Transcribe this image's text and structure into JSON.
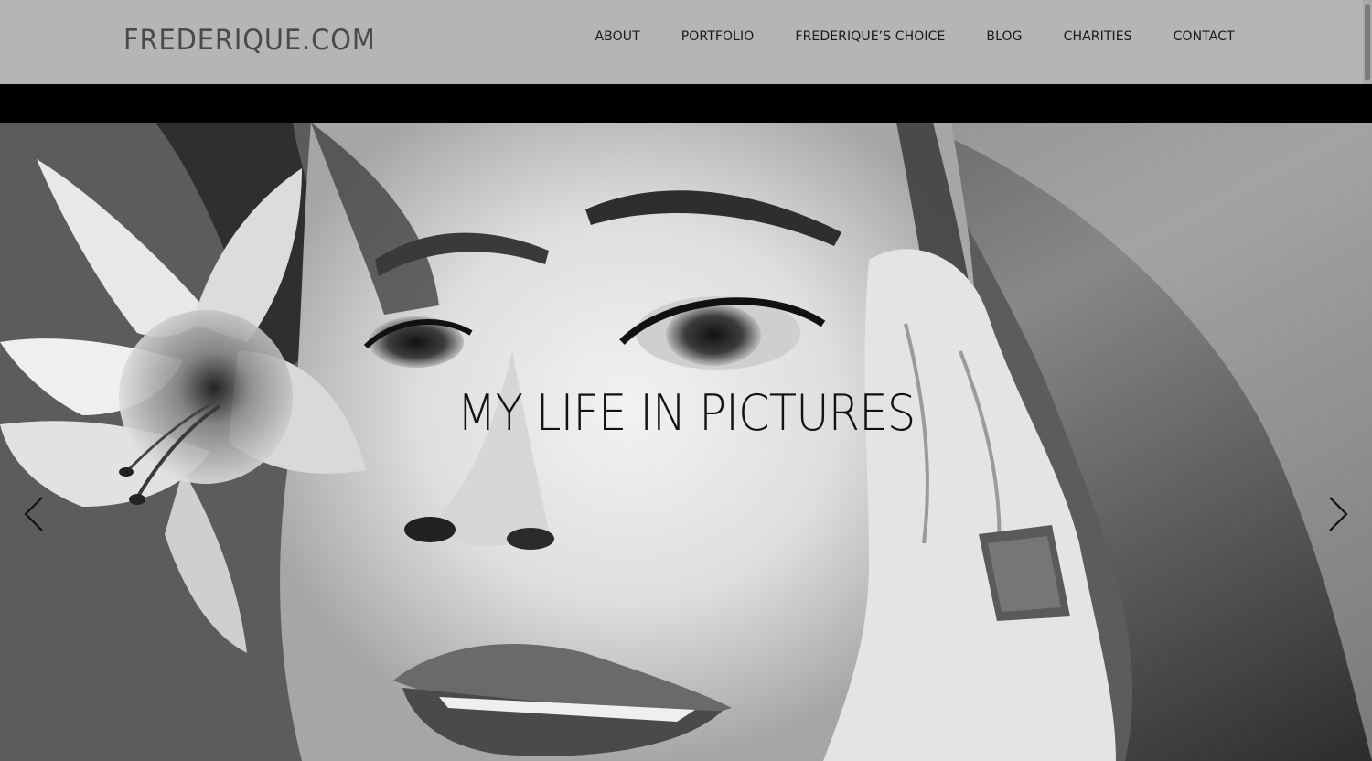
{
  "header": {
    "logo": "FREDERIQUE.COM",
    "nav": [
      {
        "label": "ABOUT"
      },
      {
        "label": "PORTFOLIO"
      },
      {
        "label": "FREDERIQUE’S CHOICE"
      },
      {
        "label": "BLOG"
      },
      {
        "label": "CHARITIES"
      },
      {
        "label": "CONTACT"
      }
    ]
  },
  "hero": {
    "title": "MY LIFE IN PICTURES",
    "image": "black-and-white-portrait-with-lily",
    "prev_icon": "chevron-left-icon",
    "next_icon": "chevron-right-icon"
  },
  "colors": {
    "header_bg": "#b5b5b5",
    "logo": "#4a4a4a",
    "nav_text": "#1a1a1a",
    "band": "#000000",
    "hero_title": "#111111"
  }
}
